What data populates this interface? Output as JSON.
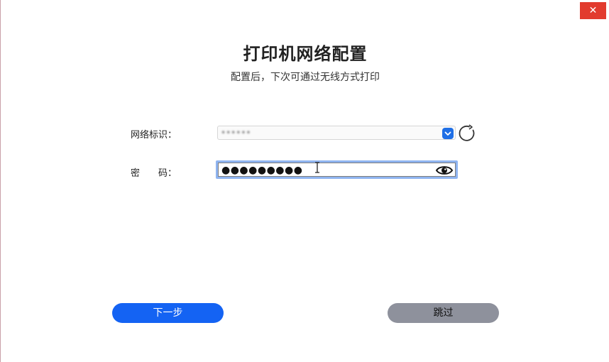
{
  "window": {
    "close_glyph": "✕"
  },
  "header": {
    "title": "打印机网络配置",
    "subtitle": "配置后，下次可通过无线方式打印"
  },
  "form": {
    "ssid_label": "网络标识：",
    "ssid_value": "••••••",
    "password_label": "密　　码：",
    "password_masked": "●●●●●●●●●"
  },
  "buttons": {
    "next_label": "下一步",
    "skip_label": "跳过"
  },
  "colors": {
    "primary": "#1463f3",
    "secondary": "#8e919c",
    "close": "#e23b2e",
    "focus_ring": "#8fb4f0"
  }
}
